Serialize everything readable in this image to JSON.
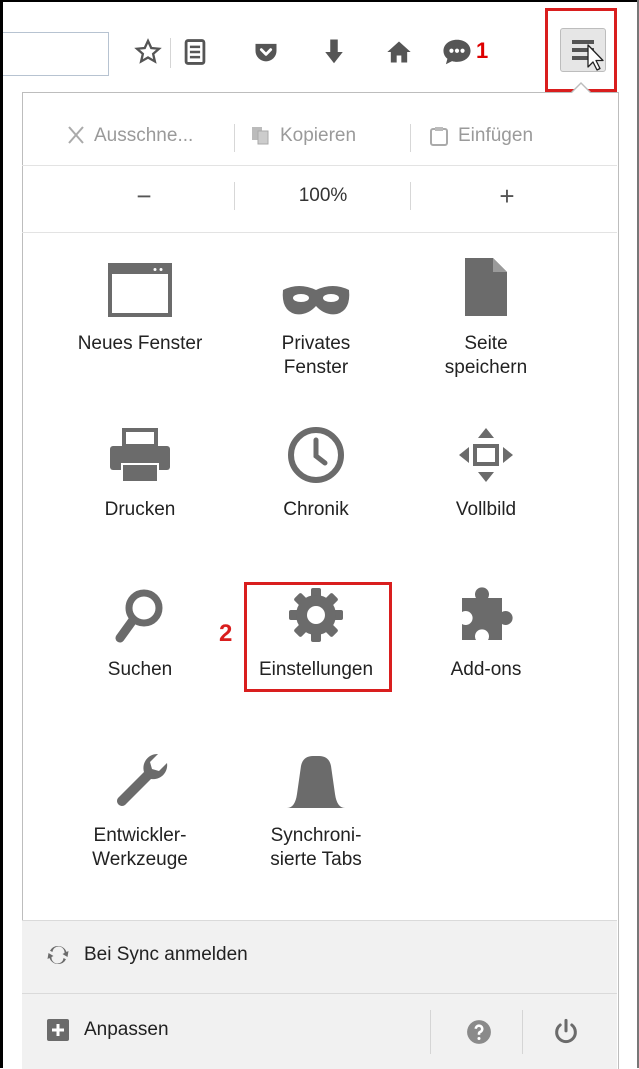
{
  "toolbar": {
    "icons": [
      "bookmark-star-icon",
      "reading-list-icon",
      "pocket-icon",
      "downloads-icon",
      "home-icon",
      "chat-icon",
      "hamburger-menu-icon"
    ],
    "annotation_1": "1"
  },
  "menu": {
    "edit": {
      "cut": "Ausschne...",
      "copy": "Kopieren",
      "paste": "Einfügen"
    },
    "zoom": {
      "minus": "−",
      "level": "100%",
      "plus": "+"
    },
    "tiles": [
      {
        "label": "Neues Fenster",
        "icon": "new-window-icon"
      },
      {
        "label": "Privates\nFenster",
        "icon": "private-mask-icon"
      },
      {
        "label": "Seite\nspeichern",
        "icon": "save-page-icon"
      },
      {
        "label": "Drucken",
        "icon": "printer-icon"
      },
      {
        "label": "Chronik",
        "icon": "history-clock-icon"
      },
      {
        "label": "Vollbild",
        "icon": "fullscreen-icon"
      },
      {
        "label": "Suchen",
        "icon": "search-icon"
      },
      {
        "label": "Einstellungen",
        "icon": "gear-icon"
      },
      {
        "label": "Add-ons",
        "icon": "puzzle-icon"
      },
      {
        "label": "Entwickler-\nWerkzeuge",
        "icon": "wrench-icon"
      },
      {
        "label": "Synchroni-\nsierte Tabs",
        "icon": "synced-tabs-icon"
      }
    ],
    "annotation_2": "2",
    "sync_label": "Bei Sync anmelden",
    "customize_label": "Anpassen"
  },
  "colors": {
    "annotation": "#d91e1e",
    "icon_gray": "#6b6b6b",
    "footer_bg": "#f1f1f1"
  }
}
